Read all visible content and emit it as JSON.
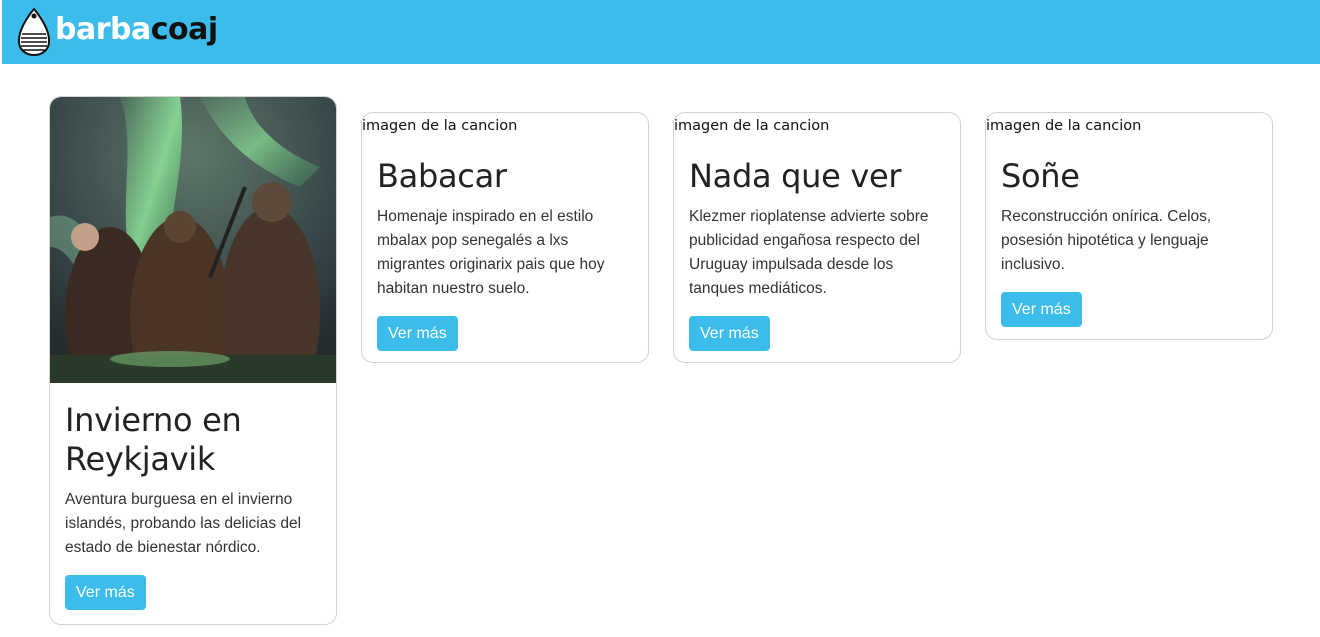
{
  "brand": {
    "part1": "barba",
    "part2": "coaj"
  },
  "colors": {
    "primary": "#3bbceb",
    "brand_dark": "#111111"
  },
  "cards": [
    {
      "title": "Invierno en Reykjavik",
      "text": "Aventura burguesa en el invierno islandés, probando las delicias del estado de bienestar nórdico.",
      "button": "Ver más"
    },
    {
      "image_alt": "imagen de la cancion",
      "title": "Babacar",
      "text": "Homenaje inspirado en el estilo mbalax pop senegalés a lxs migrantes originarix pais que hoy habitan nuestro suelo.",
      "button": "Ver más"
    },
    {
      "image_alt": "imagen de la cancion",
      "title": "Nada que ver",
      "text": "Klezmer rioplatense advierte sobre publicidad engañosa respecto del Uruguay impulsada desde los tanques mediáticos.",
      "button": "Ver más"
    },
    {
      "image_alt": "imagen de la cancion",
      "title": "Soñe",
      "text": "Reconstrucción onírica. Celos, posesión hipotética y lenguaje inclusivo.",
      "button": "Ver más"
    }
  ]
}
